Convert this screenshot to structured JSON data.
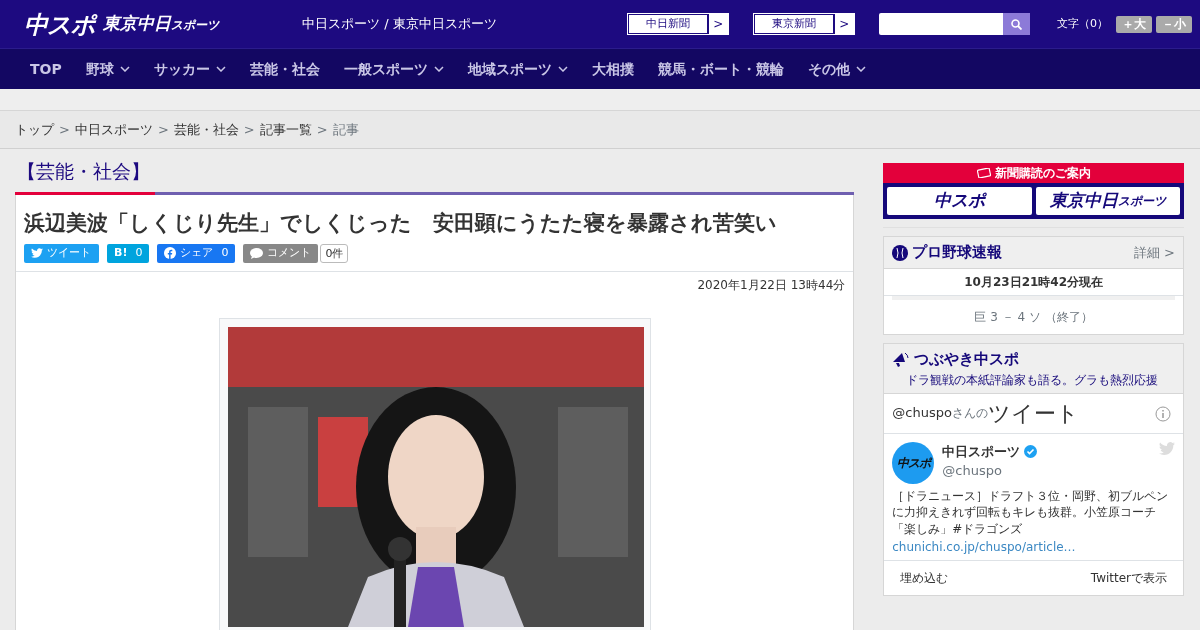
{
  "header": {
    "logo_main": "中スポ",
    "logo_sub": "東京中日",
    "logo_sub_small": "スポーツ",
    "site_title": "中日スポーツ / 東京中日スポーツ",
    "paper_links": [
      {
        "label": "中日新聞",
        "arrow": ">"
      },
      {
        "label": "東京新聞",
        "arrow": ">"
      }
    ],
    "font_size_label": "文字（0）",
    "font_buttons": [
      "＋大",
      "－小"
    ]
  },
  "nav": {
    "items": [
      {
        "label": "TOP",
        "dropdown": false
      },
      {
        "label": "野球",
        "dropdown": true
      },
      {
        "label": "サッカー",
        "dropdown": true
      },
      {
        "label": "芸能・社会",
        "dropdown": false
      },
      {
        "label": "一般スポーツ",
        "dropdown": true
      },
      {
        "label": "地域スポーツ",
        "dropdown": true
      },
      {
        "label": "大相撲",
        "dropdown": false
      },
      {
        "label": "競馬・ボート・競輪",
        "dropdown": false
      },
      {
        "label": "その他",
        "dropdown": true
      }
    ]
  },
  "breadcrumb": {
    "separator": ">",
    "items": [
      {
        "label": "トップ",
        "link": true
      },
      {
        "label": "中日スポーツ",
        "link": true
      },
      {
        "label": "芸能・社会",
        "link": true
      },
      {
        "label": "記事一覧",
        "link": true
      },
      {
        "label": "記事",
        "link": false
      }
    ]
  },
  "category": "【芸能・社会】",
  "article": {
    "headline": "浜辺美波「しくじり先生」でしくじった　安田顕にうたた寝を暴露され苦笑い",
    "share_buttons": [
      {
        "kind": "twitter",
        "label": "ツイート"
      },
      {
        "kind": "hatena",
        "label": "B!",
        "count": "0"
      },
      {
        "kind": "facebook",
        "label": "シェア",
        "count": "0"
      },
      {
        "kind": "comment",
        "label": "コメント"
      }
    ],
    "comment_count": "0件",
    "date": "2020年1月22日 13時44分"
  },
  "sidebar": {
    "subscription": {
      "heading": "新聞購読のご案内",
      "logo_main": "中スポ",
      "logo_sub": "東京中日",
      "logo_sub_small": "スポーツ"
    },
    "baseball": {
      "title": "プロ野球速報",
      "more": "詳細 >",
      "updated": "10月23日21時42分現在",
      "score": "巨 3 － 4 ソ （終了）"
    },
    "tweets": {
      "title": "つぶやき中スポ",
      "subtitle": "ドラ観戦の本紙評論家も語る。グラも熱烈応援",
      "handle_link": "@chuspo",
      "handle_suffix": "さんの",
      "timeline_title": "ツイート",
      "tweet": {
        "avatar_text": "中スポ",
        "name": "中日スポーツ",
        "verified": true,
        "handle": "@chuspo",
        "text": "［ドラニュース］ドラフト３位・岡野、初ブルペンに力抑えきれず回転もキレも抜群。小笠原コーチ「楽しみ」",
        "hashtag": "#ドラゴンズ",
        "link": "chunichi.co.jp/chuspo/article…"
      },
      "footer_left": "埋め込む",
      "footer_right": "Twitterで表示"
    }
  }
}
